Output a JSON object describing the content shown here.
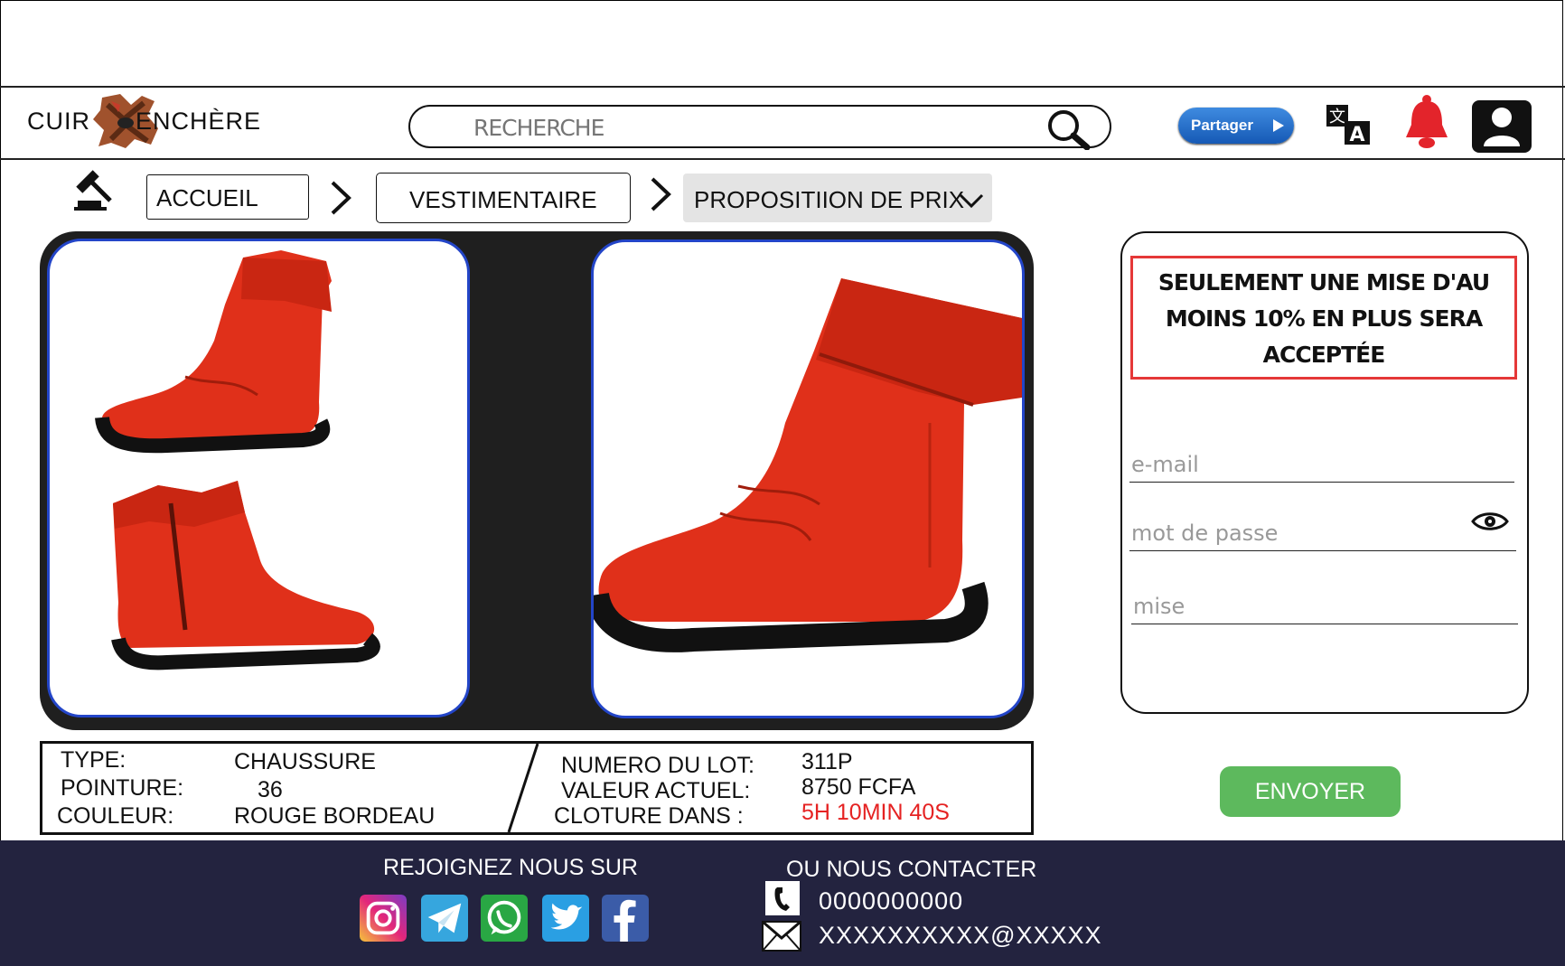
{
  "header": {
    "logo_left": "CUIR",
    "logo_right": "ENCHÈRE",
    "search_placeholder": "RECHERCHE",
    "share_label": "Partager"
  },
  "breadcrumb": {
    "items": [
      "ACCUEIL",
      "VESTIMENTAIRE",
      "PROPOSITIION DE PRIX"
    ]
  },
  "product": {
    "type_label": "TYPE:",
    "type_value": "CHAUSSURE",
    "size_label": "POINTURE:",
    "size_value": "36",
    "color_label": "COULEUR:",
    "color_value": "ROUGE BORDEAU",
    "lot_label": "NUMERO DU LOT:",
    "lot_value": "311P",
    "value_label": "VALEUR ACTUEL:",
    "value_value": "8750 FCFA",
    "close_label": "CLOTURE DANS :",
    "close_value": "5H 10MIN 40S"
  },
  "bid_form": {
    "notice": "SEULEMENT UNE MISE D'AU MOINS 10% EN PLUS SERA ACCEPTÉE",
    "email_placeholder": "e-mail",
    "password_placeholder": "mot de passe",
    "bid_placeholder": "mise",
    "submit_label": "ENVOYER"
  },
  "footer": {
    "join_title": "REJOIGNEZ NOUS SUR",
    "contact_title": "OU NOUS CONTACTER",
    "phone": "0000000000",
    "email": "XXXXXXXXXX@XXXXX",
    "socials": [
      "instagram-icon",
      "telegram-icon",
      "whatsapp-icon",
      "twitter-icon",
      "facebook-icon"
    ]
  },
  "colors": {
    "accent_blue": "#2345c8",
    "alert_red": "#e53838",
    "submit_green": "#5db95d",
    "footer_bg": "#23233f",
    "boot_red": "#e0301a"
  }
}
